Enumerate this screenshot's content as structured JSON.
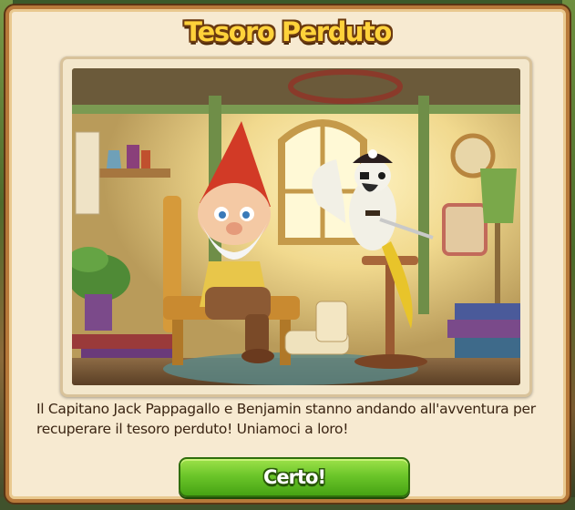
{
  "dialog": {
    "title": "Tesoro Perduto",
    "description": "Il Capitano Jack Pappagallo e Benjamin stanno andando all'avventura per recuperare il tesoro perduto! Uniamoci a loro!",
    "confirm_label": "Certo!"
  },
  "illustration": {
    "scene": "illustration-gnome-and-pirate-parrot-in-cabin",
    "icons": [
      "gnome-icon",
      "pirate-parrot-icon"
    ]
  },
  "colors": {
    "title_fill": "#ffd23a",
    "panel_bg": "#f7ead1",
    "panel_border": "#b7793a",
    "button_green": "#6cc62a"
  }
}
